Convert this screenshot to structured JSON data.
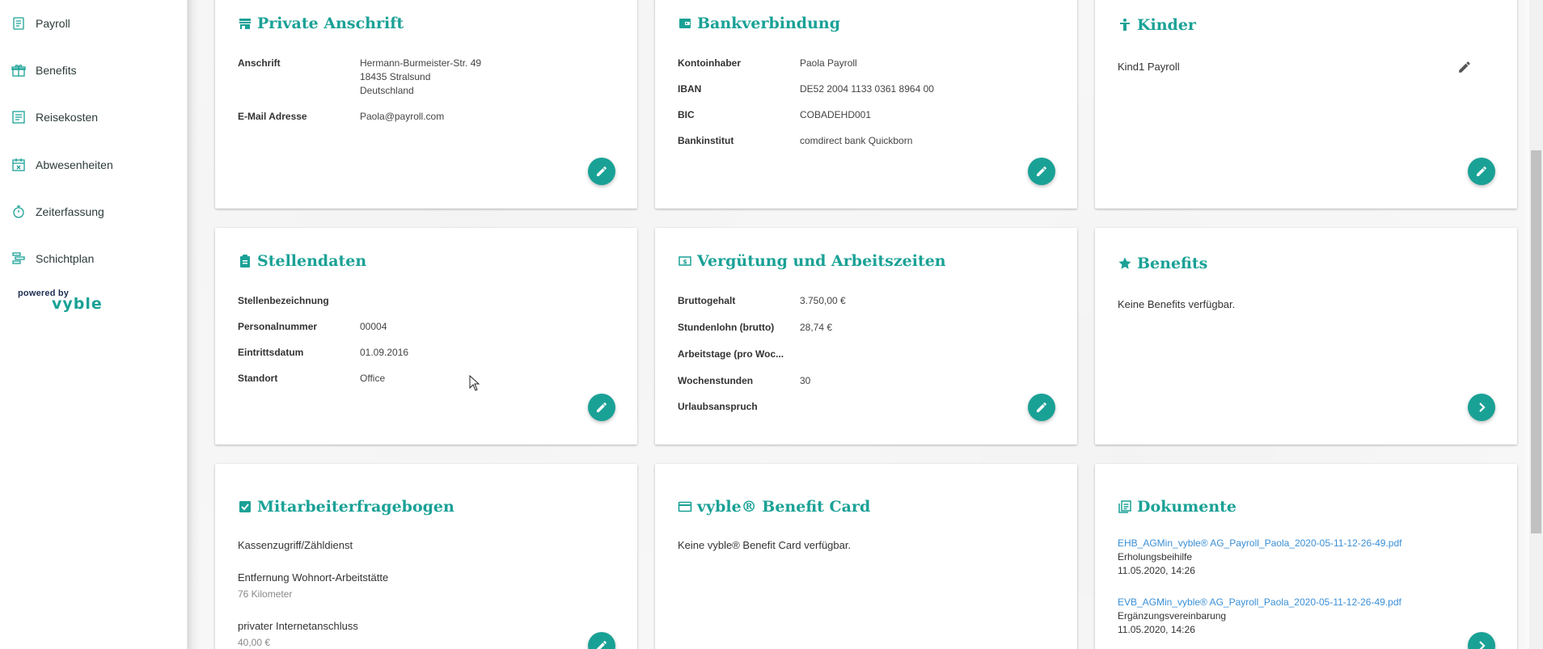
{
  "sidebar": {
    "items": [
      {
        "label": "Payroll",
        "icon": "payroll-icon"
      },
      {
        "label": "Benefits",
        "icon": "gift-icon"
      },
      {
        "label": "Reisekosten",
        "icon": "receipt-icon"
      },
      {
        "label": "Abwesenheiten",
        "icon": "calendar-x-icon"
      },
      {
        "label": "Zeiterfassung",
        "icon": "stopwatch-icon"
      },
      {
        "label": "Schichtplan",
        "icon": "shift-plan-icon"
      }
    ],
    "powered_by": "powered by",
    "brand": "vyble"
  },
  "cards": {
    "anschrift": {
      "title": "Private Anschrift",
      "rows": [
        {
          "label": "Anschrift",
          "value": "Hermann-Burmeister-Str. 49\n18435 Stralsund\nDeutschland"
        },
        {
          "label": "E-Mail Adresse",
          "value": "Paola@payroll.com"
        }
      ]
    },
    "bank": {
      "title": "Bankverbindung",
      "rows": [
        {
          "label": "Kontoinhaber",
          "value": "Paola Payroll"
        },
        {
          "label": "IBAN",
          "value": "DE52 2004 1133 0361 8964 00"
        },
        {
          "label": "BIC",
          "value": "COBADEHD001"
        },
        {
          "label": "Bankinstitut",
          "value": "comdirect bank Quickborn"
        }
      ]
    },
    "kinder": {
      "title": "Kinder",
      "child": "Kind1 Payroll"
    },
    "stellen": {
      "title": "Stellendaten",
      "rows": [
        {
          "label": "Stellenbezeichnung",
          "value": ""
        },
        {
          "label": "Personalnummer",
          "value": "00004"
        },
        {
          "label": "Eintrittsdatum",
          "value": "01.09.2016"
        },
        {
          "label": "Standort",
          "value": "Office"
        }
      ]
    },
    "verguetung": {
      "title": "Vergütung und Arbeitszeiten",
      "rows": [
        {
          "label": "Bruttogehalt",
          "value": "3.750,00 €"
        },
        {
          "label": "Stundenlohn (brutto)",
          "value": "28,74 €"
        },
        {
          "label": "Arbeitstage (pro Woc...",
          "value": ""
        },
        {
          "label": "Wochenstunden",
          "value": "30"
        },
        {
          "label": "Urlaubsanspruch",
          "value": ""
        }
      ]
    },
    "benefits": {
      "title": "Benefits",
      "text": "Keine Benefits verfügbar."
    },
    "fragebogen": {
      "title": "Mitarbeiterfragebogen",
      "items": [
        {
          "label": "Kassenzugriff/Zähldienst",
          "sub": ""
        },
        {
          "label": "Entfernung Wohnort-Arbeitstätte",
          "sub": "76 Kilometer"
        },
        {
          "label": "privater Internetanschluss",
          "sub": "40,00 €"
        }
      ]
    },
    "benefitcard": {
      "title": "vyble® Benefit Card",
      "text": "Keine vyble® Benefit Card verfügbar."
    },
    "dokumente": {
      "title": "Dokumente",
      "docs": [
        {
          "file": "EHB_AGMin_vyble® AG_Payroll_Paola_2020-05-11-12-26-49.pdf",
          "type": "Erholungsbeihilfe",
          "date": "11.05.2020, 14:26"
        },
        {
          "file": "EVB_AGMin_vyble® AG_Payroll_Paola_2020-05-11-12-26-49.pdf",
          "type": "Ergänzungsvereinbarung",
          "date": "11.05.2020, 14:26"
        }
      ]
    }
  },
  "colors": {
    "accent": "#1aa196",
    "link": "#3a8fd6",
    "brand_dark": "#1d2e52"
  }
}
